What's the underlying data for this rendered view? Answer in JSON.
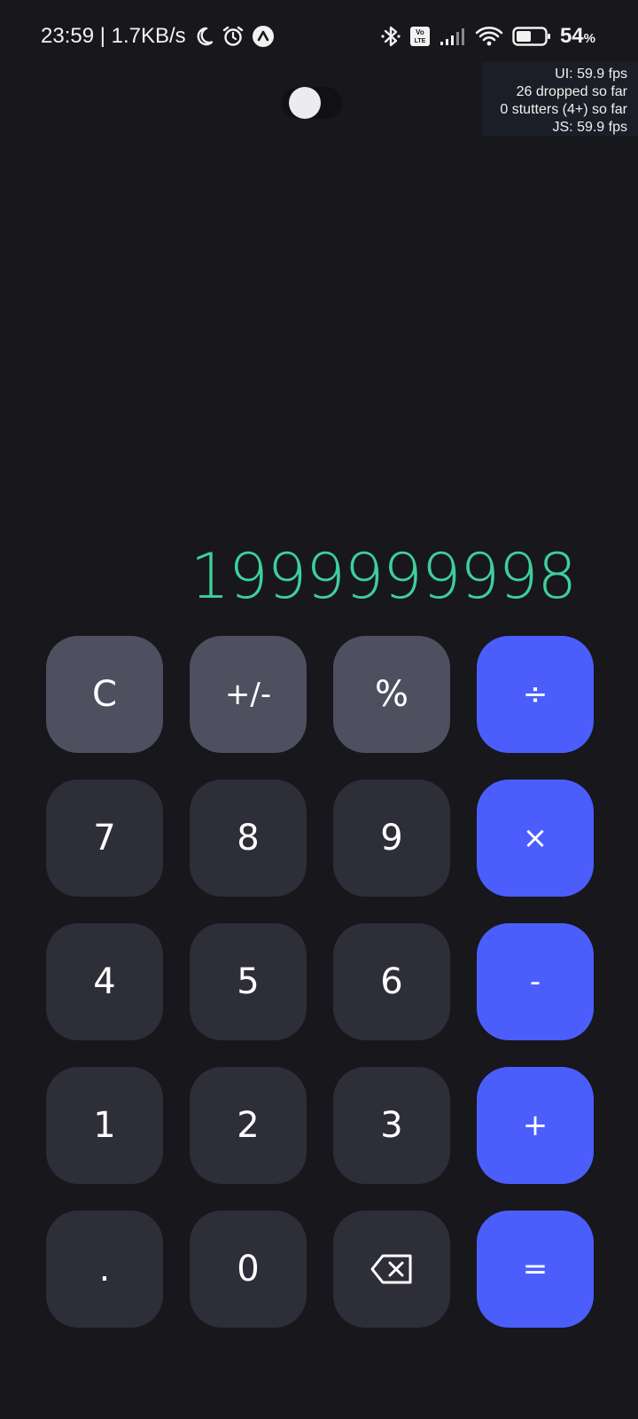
{
  "status_bar": {
    "time_speed": "23:59 | 1.7KB/s",
    "battery_number": "54",
    "battery_unit": "%",
    "icons": [
      "moon-icon",
      "alarm-icon",
      "nav-app-icon",
      "bluetooth-icon",
      "volte-icon",
      "signal-icon",
      "wifi-icon",
      "battery-icon"
    ]
  },
  "perf_overlay": {
    "ui_fps": "UI: 59.9 fps",
    "dropped": "26 dropped so far",
    "stutters": "0 stutters (4+) so far",
    "js_fps": "JS: 59.9 fps"
  },
  "theme_toggle": {
    "state": "off"
  },
  "display": {
    "value": "1999999998"
  },
  "keypad": {
    "clear": "C",
    "sign": "+/-",
    "percent": "%",
    "divide": "÷",
    "seven": "7",
    "eight": "8",
    "nine": "9",
    "multiply": "×",
    "four": "4",
    "five": "5",
    "six": "6",
    "minus": "-",
    "one": "1",
    "two": "2",
    "three": "3",
    "plus": "+",
    "decimal": ".",
    "zero": "0",
    "backspace_icon": "backspace-icon",
    "equals": "="
  },
  "colors": {
    "background": "#17171c",
    "display_text": "#3fcf9a",
    "number_key": "#2d2e38",
    "function_key": "#4e505f",
    "operator_key": "#4b5efc"
  }
}
